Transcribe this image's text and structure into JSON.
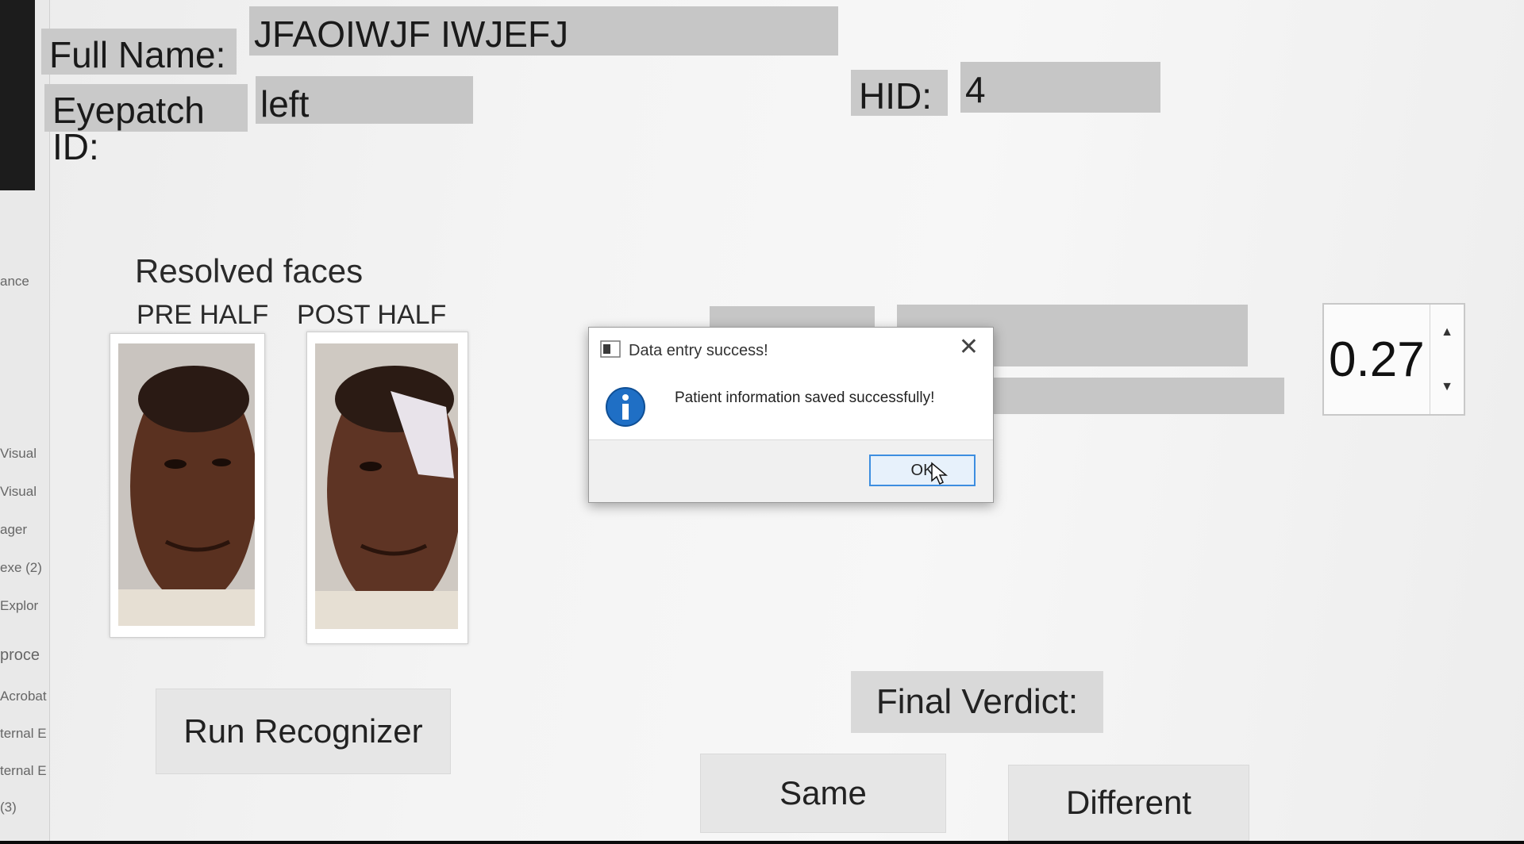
{
  "header": {
    "full_name_label": "Full Name:",
    "full_name_value": "JFAOIWJF IWJEFJ",
    "eyepatch_label": "Eyepatch ID:",
    "eyepatch_value": "left",
    "hid_label": "HID:",
    "hid_value": "4"
  },
  "faces": {
    "heading": "Resolved faces",
    "pre_label": "PRE HALF",
    "post_label": "POST HALF"
  },
  "threshold": {
    "value": "0.27",
    "up_icon": "chevron-up-icon",
    "down_icon": "chevron-down-icon"
  },
  "actions": {
    "run_recognizer": "Run Recognizer",
    "final_verdict_label": "Final Verdict:",
    "same": "Same",
    "different": "Different"
  },
  "dialog": {
    "title": "Data entry success!",
    "message": "Patient information saved successfully!",
    "ok": "OK",
    "icon": "info-icon"
  },
  "background_sidebar": {
    "items": [
      "ance",
      "Visual",
      "Visual",
      "ager",
      "exe (2)",
      "Explor",
      "proce",
      "Acrobat",
      "ternal E",
      "ternal E",
      "(3)"
    ]
  },
  "colors": {
    "accent": "#3d8ee0",
    "info_blue": "#1f6fc5",
    "field_gray": "#c6c6c6"
  }
}
